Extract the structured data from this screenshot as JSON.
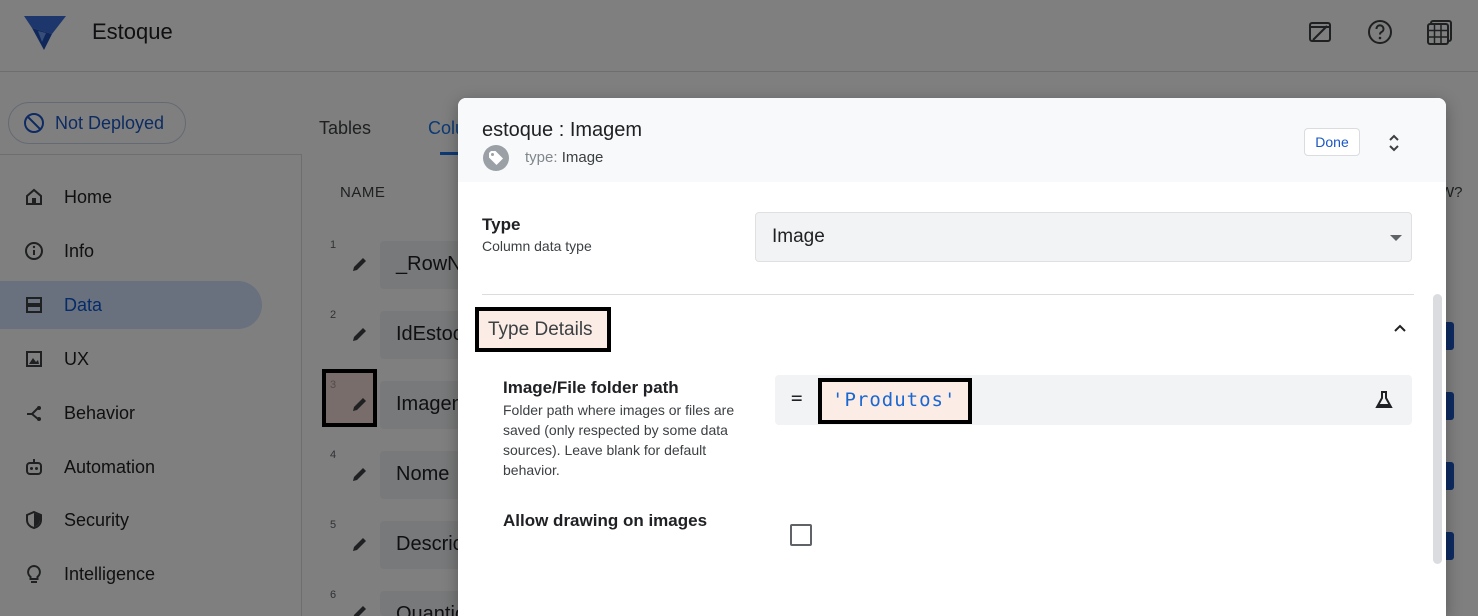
{
  "app": {
    "title": "Estoque"
  },
  "deploy": {
    "label": "Not Deployed"
  },
  "tabs": [
    {
      "label": "Tables"
    },
    {
      "label": "Colu"
    }
  ],
  "sidebar": {
    "items": [
      {
        "label": "Home",
        "icon": "home-icon"
      },
      {
        "label": "Info",
        "icon": "info-icon"
      },
      {
        "label": "Data",
        "icon": "data-icon",
        "active": true
      },
      {
        "label": "UX",
        "icon": "ux-icon"
      },
      {
        "label": "Behavior",
        "icon": "behavior-icon"
      },
      {
        "label": "Automation",
        "icon": "automation-icon"
      },
      {
        "label": "Security",
        "icon": "shield-icon"
      },
      {
        "label": "Intelligence",
        "icon": "lightbulb-icon"
      }
    ]
  },
  "columns": {
    "header": "NAME",
    "right_header": "W?",
    "rows": [
      {
        "num": "1",
        "name": "_RowN"
      },
      {
        "num": "2",
        "name": "IdEstoc"
      },
      {
        "num": "3",
        "name": "Imagen"
      },
      {
        "num": "4",
        "name": "Nome"
      },
      {
        "num": "5",
        "name": "Descric"
      },
      {
        "num": "6",
        "name": "Quantio"
      }
    ]
  },
  "dialog": {
    "title": "estoque : Imagem",
    "type_caption_label": "type:",
    "type_caption_value": "Image",
    "done_label": "Done",
    "type_field": {
      "label": "Type",
      "help": "Column data type",
      "value": "Image"
    },
    "section_title": "Type Details",
    "folder_field": {
      "label": "Image/File folder path",
      "help": "Folder path where images or files are saved (only respected by some data sources). Leave blank for default behavior.",
      "equals": "=",
      "value": "'Produtos'"
    },
    "drawing_field": {
      "label": "Allow drawing on images",
      "checked": false
    }
  }
}
